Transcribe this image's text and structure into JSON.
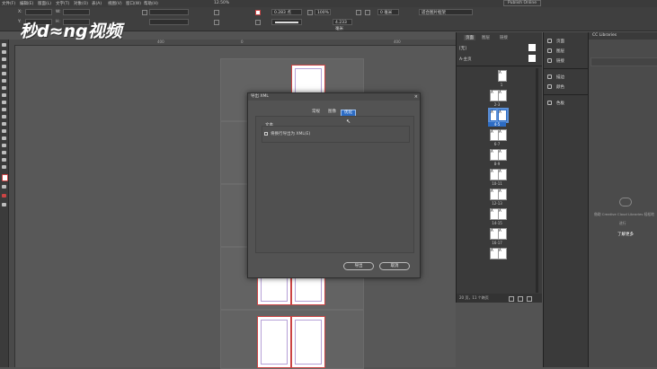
{
  "menubar": {
    "items": [
      "文件(F)",
      "编辑(E)",
      "版面(L)",
      "文字(T)",
      "对象(O)",
      "表(A)",
      "视图(V)",
      "窗口(W)",
      "帮助(H)"
    ],
    "zoom": "12.50%",
    "workspace": "Publish Online"
  },
  "controlbar": {
    "x_label": "X:",
    "y_label": "Y:",
    "w_label": "W:",
    "h_label": "H:",
    "x_value": "",
    "stroke_weight": "0.283 点",
    "pct": "100%",
    "mm_value": "4.233 毫米",
    "zero_mm": "0 毫米",
    "fit_option": "适合图片框架"
  },
  "watermark": {
    "text": "秒d≈ng视频"
  },
  "ruler": {
    "ticks": [
      "400",
      "0",
      "400"
    ]
  },
  "dialog": {
    "title": "导出 XML",
    "close": "×",
    "tabs": [
      "常规",
      "图像",
      "优化"
    ],
    "active_tab": 2,
    "group_label": "文本",
    "checkbox_label": "将换行导出为 XML(E)",
    "export_button": "导出",
    "cancel_button": "取消"
  },
  "pages_panel": {
    "tabs": [
      "页面",
      "图层",
      "链接"
    ],
    "none_label": "[无]",
    "master_label": "A-主页",
    "page_labels": [
      "1",
      "2-3",
      "4-5",
      "6-7",
      "8-9",
      "10-11",
      "12-13",
      "14-15",
      "16-17"
    ],
    "selected_index": 2,
    "footer": "20 页，11 个跨页"
  },
  "dock": {
    "items": [
      "页面",
      "图层",
      "链接",
      "描边",
      "颜色",
      "色板"
    ]
  },
  "cc_libraries": {
    "title": "CC Libraries",
    "message": "借助 Creative Cloud Libraries 轻松地",
    "link": "了解更多",
    "message2": "进行"
  },
  "colors": {
    "accent": "#2d6cc4",
    "page_border": "#cc4444",
    "margin_guide": "#b6a0d6"
  }
}
